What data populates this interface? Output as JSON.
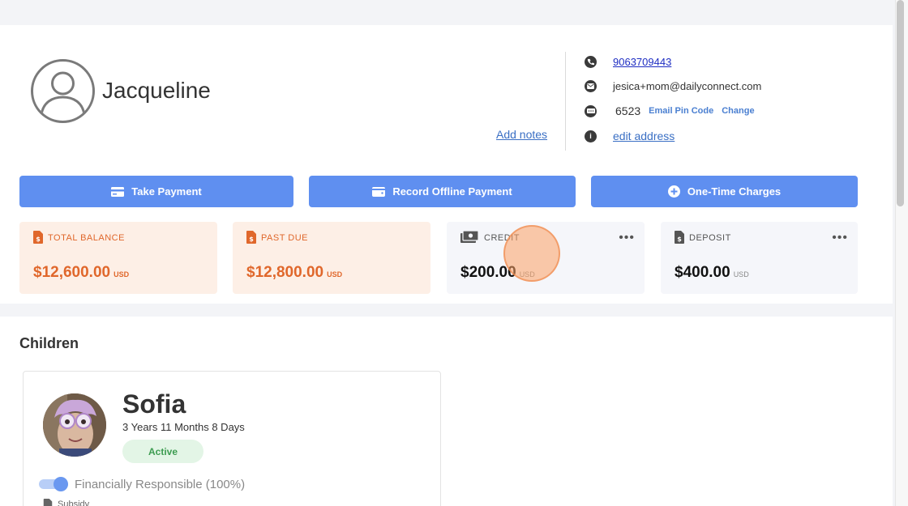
{
  "profile": {
    "name": "Jacqueline",
    "add_notes": "Add notes"
  },
  "contact": {
    "phone": "9063709443",
    "email": "jesica+mom@dailyconnect.com",
    "pin": "6523",
    "email_pin_label": "Email Pin Code",
    "change_label": "Change",
    "address_label": "edit address"
  },
  "actions": {
    "take_payment": "Take Payment",
    "record_offline": "Record Offline Payment",
    "one_time": "One-Time Charges"
  },
  "stats": {
    "total_balance": {
      "label": "TOTAL BALANCE",
      "amount": "$12,600.00",
      "unit": "USD"
    },
    "past_due": {
      "label": "PAST DUE",
      "amount": "$12,800.00",
      "unit": "USD"
    },
    "credit": {
      "label": "CREDIT",
      "amount": "$200.00",
      "unit": "USD"
    },
    "deposit": {
      "label": "DEPOSIT",
      "amount": "$400.00",
      "unit": "USD"
    },
    "menu_glyph": "•••"
  },
  "children": {
    "section_title": "Children",
    "items": [
      {
        "name": "Sofia",
        "age": "3 Years 11 Months 8 Days",
        "status": "Active",
        "financial_label": "Financially Responsible (100%)",
        "financial_on": true,
        "subsidy_label": "Subsidy"
      }
    ]
  },
  "colors": {
    "primary_button": "#5f8ff0",
    "orange_accent": "#e0672b",
    "orange_tile": "#fdefe6",
    "gray_tile": "#f5f6fa",
    "active_green": "#3d9c51"
  },
  "icons": {
    "phone": "phone-icon",
    "email": "email-icon",
    "pin": "keypad-icon",
    "info": "info-icon"
  }
}
